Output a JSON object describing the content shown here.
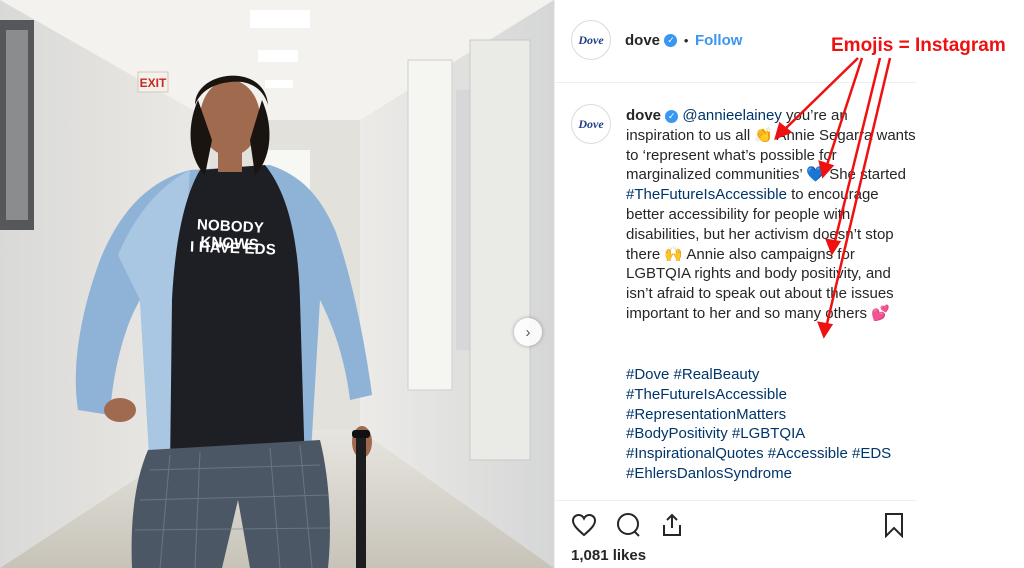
{
  "post": {
    "username": "dove",
    "verified_mark": "✓",
    "separator": "•",
    "follow_label": "Follow",
    "avatar_logo": "Dove",
    "caption_mention": "@annieelainey",
    "caption_parts": [
      " you’re an inspiration to us all ",
      " Annie Segarra wants to ‘represent what’s possible for marginalized communities’ ",
      " She started ",
      " to encourage better accessibility for people with disabilities, but her activism doesn’t stop there ",
      " Annie also campaigns for LGBTQIA rights and body positivity, and isn’t afraid to speak out about the issues important to her and so many others "
    ],
    "caption_hashtag": "#TheFutureIsAccessible",
    "emojis": [
      "👏",
      "💙",
      "🙌",
      "💕"
    ],
    "hashtags": [
      "#Dove",
      "#RealBeauty",
      "#TheFutureIsAccessible",
      "#RepresentationMatters",
      "#BodyPositivity",
      "#LGBTQIA",
      "#InspirationalQuotes",
      "#Accessible",
      "#EDS",
      "#EhlersDanlosSyndrome"
    ],
    "likes": "1,081 likes"
  },
  "photo": {
    "exit_sign": "EXIT",
    "shirt_line1": "NOBODY KNOWS",
    "shirt_line2": "I HAVE EDS",
    "next_arrow": "›"
  },
  "annotation": {
    "text": "Emojis = Instagram",
    "color": "#ee1111"
  },
  "icons": {
    "like": "heart-icon",
    "comment": "comment-icon",
    "share": "share-icon",
    "save": "bookmark-icon"
  }
}
